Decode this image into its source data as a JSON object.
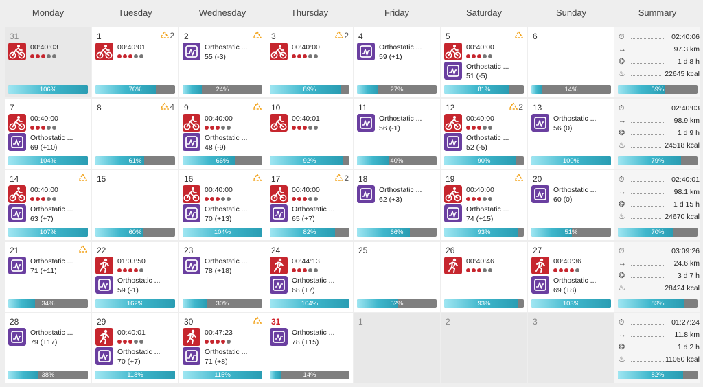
{
  "headers": [
    "Monday",
    "Tuesday",
    "Wednesday",
    "Thursday",
    "Friday",
    "Saturday",
    "Sunday",
    "Summary"
  ],
  "colors": {
    "activity_red": "#c6262e",
    "ortho_purple": "#6a3fa0",
    "bar_gray": "#7f7f7f",
    "today": "#d0202a",
    "badge_orange": "#f2a31b"
  },
  "weeks": [
    {
      "days": [
        {
          "day": "31",
          "off": true,
          "entries": [
            {
              "type": "bike",
              "text": "00:40:03",
              "dots": 3
            }
          ],
          "progress": 106,
          "progress_label": "106%"
        },
        {
          "day": "1",
          "badge": "2",
          "entries": [
            {
              "type": "bike",
              "text": "00:40:01",
              "dots": 3
            }
          ],
          "progress": 76,
          "progress_label": "76%"
        },
        {
          "day": "2",
          "badge": "",
          "entries": [
            {
              "type": "ortho",
              "text": "Orthostatic ...",
              "sub": "55 (-3)"
            }
          ],
          "progress": 24,
          "progress_label": "24%"
        },
        {
          "day": "3",
          "badge": "2",
          "entries": [
            {
              "type": "bike",
              "text": "00:40:00",
              "dots": 3
            }
          ],
          "progress": 89,
          "progress_label": "89%"
        },
        {
          "day": "4",
          "entries": [
            {
              "type": "ortho",
              "text": "Orthostatic ...",
              "sub": "59 (+1)"
            }
          ],
          "progress": 27,
          "progress_label": "27%"
        },
        {
          "day": "5",
          "badge": "",
          "entries": [
            {
              "type": "bike",
              "text": "00:40:00",
              "dots": 3
            },
            {
              "type": "ortho",
              "text": "Orthostatic ...",
              "sub": "51 (-5)"
            }
          ],
          "progress": 81,
          "progress_label": "81%"
        },
        {
          "day": "6",
          "entries": [],
          "progress": 14,
          "progress_label": "14%"
        }
      ],
      "summary": {
        "time": "02:40:06",
        "dist": "97.3 km",
        "load": "1 d 8 h",
        "kcal": "22645 kcal",
        "progress": 59,
        "progress_label": "59%"
      }
    },
    {
      "days": [
        {
          "day": "7",
          "entries": [
            {
              "type": "bike",
              "text": "00:40:00",
              "dots": 3
            },
            {
              "type": "ortho",
              "text": "Orthostatic ...",
              "sub": "69 (+10)"
            }
          ],
          "progress": 104,
          "progress_label": "104%"
        },
        {
          "day": "8",
          "badge": "4",
          "entries": [],
          "progress": 61,
          "progress_label": "61%"
        },
        {
          "day": "9",
          "badge": "",
          "entries": [
            {
              "type": "bike",
              "text": "00:40:00",
              "dots": 3
            },
            {
              "type": "ortho",
              "text": "Orthostatic ...",
              "sub": "48 (-9)"
            }
          ],
          "progress": 66,
          "progress_label": "66%"
        },
        {
          "day": "10",
          "entries": [
            {
              "type": "bike",
              "text": "00:40:01",
              "dots": 3
            }
          ],
          "progress": 92,
          "progress_label": "92%"
        },
        {
          "day": "11",
          "entries": [
            {
              "type": "ortho",
              "text": "Orthostatic ...",
              "sub": "56 (-1)"
            }
          ],
          "progress": 40,
          "progress_label": "40%"
        },
        {
          "day": "12",
          "badge": "2",
          "entries": [
            {
              "type": "bike",
              "text": "00:40:00",
              "dots": 3
            },
            {
              "type": "ortho",
              "text": "Orthostatic ...",
              "sub": "52 (-5)"
            }
          ],
          "progress": 90,
          "progress_label": "90%"
        },
        {
          "day": "13",
          "entries": [
            {
              "type": "ortho",
              "text": "Orthostatic ...",
              "sub": "56 (0)"
            }
          ],
          "progress": 100,
          "progress_label": "100%"
        }
      ],
      "summary": {
        "time": "02:40:03",
        "dist": "98.9 km",
        "load": "1 d 9 h",
        "kcal": "24518 kcal",
        "progress": 79,
        "progress_label": "79%"
      }
    },
    {
      "days": [
        {
          "day": "14",
          "badge": "",
          "entries": [
            {
              "type": "bike",
              "text": "00:40:00",
              "dots": 3
            },
            {
              "type": "ortho",
              "text": "Orthostatic ...",
              "sub": "63 (+7)"
            }
          ],
          "progress": 107,
          "progress_label": "107%"
        },
        {
          "day": "15",
          "entries": [],
          "progress": 60,
          "progress_label": "60%"
        },
        {
          "day": "16",
          "badge": "",
          "entries": [
            {
              "type": "bike",
              "text": "00:40:00",
              "dots": 3
            },
            {
              "type": "ortho",
              "text": "Orthostatic ...",
              "sub": "70 (+13)"
            }
          ],
          "progress": 104,
          "progress_label": "104%"
        },
        {
          "day": "17",
          "badge": "2",
          "entries": [
            {
              "type": "bike",
              "text": "00:40:00",
              "dots": 3
            },
            {
              "type": "ortho",
              "text": "Orthostatic ...",
              "sub": "65 (+7)"
            }
          ],
          "progress": 82,
          "progress_label": "82%"
        },
        {
          "day": "18",
          "entries": [
            {
              "type": "ortho",
              "text": "Orthostatic ...",
              "sub": "62 (+3)"
            }
          ],
          "progress": 66,
          "progress_label": "66%"
        },
        {
          "day": "19",
          "badge": "",
          "entries": [
            {
              "type": "bike",
              "text": "00:40:00",
              "dots": 3
            },
            {
              "type": "ortho",
              "text": "Orthostatic ...",
              "sub": "74 (+15)"
            }
          ],
          "progress": 93,
          "progress_label": "93%"
        },
        {
          "day": "20",
          "entries": [
            {
              "type": "ortho",
              "text": "Orthostatic ...",
              "sub": "60 (0)"
            }
          ],
          "progress": 51,
          "progress_label": "51%"
        }
      ],
      "summary": {
        "time": "02:40:01",
        "dist": "98.1 km",
        "load": "1 d 15 h",
        "kcal": "24670 kcal",
        "progress": 70,
        "progress_label": "70%"
      }
    },
    {
      "days": [
        {
          "day": "21",
          "badge": "",
          "entries": [
            {
              "type": "ortho",
              "text": "Orthostatic ...",
              "sub": "71 (+11)"
            }
          ],
          "progress": 34,
          "progress_label": "34%"
        },
        {
          "day": "22",
          "entries": [
            {
              "type": "run",
              "text": "01:03:50",
              "dots": 4
            },
            {
              "type": "ortho",
              "text": "Orthostatic ...",
              "sub": "59 (-1)"
            }
          ],
          "progress": 162,
          "progress_label": "162%"
        },
        {
          "day": "23",
          "entries": [
            {
              "type": "ortho",
              "text": "Orthostatic ...",
              "sub": "78 (+18)"
            }
          ],
          "progress": 30,
          "progress_label": "30%"
        },
        {
          "day": "24",
          "entries": [
            {
              "type": "run",
              "text": "00:44:13",
              "dots": 3
            },
            {
              "type": "ortho",
              "text": "Orthostatic ...",
              "sub": "68 (+7)"
            }
          ],
          "progress": 104,
          "progress_label": "104%"
        },
        {
          "day": "25",
          "entries": [],
          "progress": 52,
          "progress_label": "52%"
        },
        {
          "day": "26",
          "entries": [
            {
              "type": "run",
              "text": "00:40:46",
              "dots": 3
            }
          ],
          "progress": 93,
          "progress_label": "93%"
        },
        {
          "day": "27",
          "entries": [
            {
              "type": "run",
              "text": "00:40:36",
              "dots": 4
            },
            {
              "type": "ortho",
              "text": "Orthostatic ...",
              "sub": "69 (+8)"
            }
          ],
          "progress": 103,
          "progress_label": "103%"
        }
      ],
      "summary": {
        "time": "03:09:26",
        "dist": "24.6 km",
        "load": "3 d 7 h",
        "kcal": "28424 kcal",
        "progress": 83,
        "progress_label": "83%"
      }
    },
    {
      "days": [
        {
          "day": "28",
          "entries": [
            {
              "type": "ortho",
              "text": "Orthostatic ...",
              "sub": "79 (+17)"
            }
          ],
          "progress": 38,
          "progress_label": "38%"
        },
        {
          "day": "29",
          "entries": [
            {
              "type": "run",
              "text": "00:40:01",
              "dots": 3
            },
            {
              "type": "ortho",
              "text": "Orthostatic ...",
              "sub": "70 (+7)"
            }
          ],
          "progress": 118,
          "progress_label": "118%"
        },
        {
          "day": "30",
          "badge": "",
          "entries": [
            {
              "type": "run",
              "text": "00:47:23",
              "dots": 4
            },
            {
              "type": "ortho",
              "text": "Orthostatic ...",
              "sub": "71 (+8)"
            }
          ],
          "progress": 115,
          "progress_label": "115%"
        },
        {
          "day": "31",
          "today": true,
          "entries": [
            {
              "type": "ortho",
              "text": "Orthostatic ...",
              "sub": "78 (+15)"
            }
          ],
          "progress": 14,
          "progress_label": "14%"
        },
        {
          "day": "1",
          "off": true,
          "entries": [],
          "progress": null
        },
        {
          "day": "2",
          "off": true,
          "entries": [],
          "progress": null
        },
        {
          "day": "3",
          "off": true,
          "entries": [],
          "progress": null
        }
      ],
      "summary": {
        "time": "01:27:24",
        "dist": "11.8 km",
        "load": "1 d 2 h",
        "kcal": "11050 kcal",
        "progress": 82,
        "progress_label": "82%"
      }
    }
  ],
  "summary_icons": [
    "stopwatch-icon",
    "distance-icon",
    "recovery-icon",
    "flame-icon"
  ]
}
